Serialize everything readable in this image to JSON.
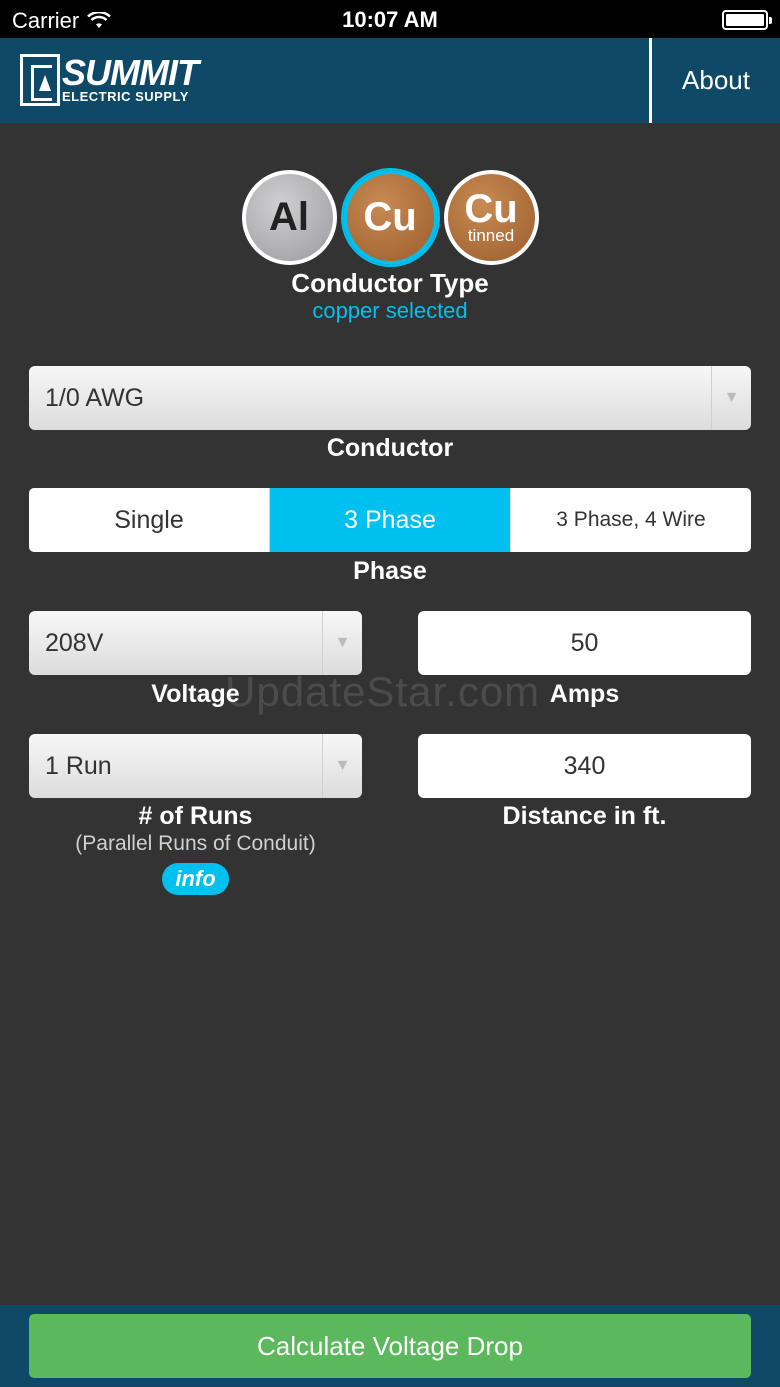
{
  "status_bar": {
    "carrier": "Carrier",
    "time": "10:07 AM",
    "wifi_icon": "wifi-icon",
    "battery_icon": "battery-icon"
  },
  "header": {
    "logo_name": "SUMMIT",
    "logo_sub": "ELECTRIC SUPPLY",
    "about_label": "About",
    "background_color": "#0e4a68"
  },
  "conductor_types": {
    "items": [
      {
        "label": "Al",
        "sub": ""
      },
      {
        "label": "Cu",
        "sub": ""
      },
      {
        "label": "Cu",
        "sub": "tinned"
      }
    ],
    "title": "Conductor Type",
    "status": "copper selected",
    "accent_color": "#00c0f0"
  },
  "conductor": {
    "value": "1/0 AWG",
    "label": "Conductor"
  },
  "phase": {
    "options": [
      "Single",
      "3 Phase",
      "3 Phase, 4 Wire"
    ],
    "selected": "3 Phase",
    "label": "Phase"
  },
  "voltage": {
    "value": "208V",
    "label": "Voltage"
  },
  "amps": {
    "value": "50",
    "label": "Amps"
  },
  "runs": {
    "value": "1 Run",
    "label": "# of Runs",
    "sub": "(Parallel Runs of Conduit)",
    "info_label": "info"
  },
  "distance": {
    "value": "340",
    "label": "Distance in ft."
  },
  "watermark": "UpdateStar.com",
  "footer": {
    "calculate_label": "Calculate Voltage Drop",
    "button_color": "#5cb85c"
  }
}
